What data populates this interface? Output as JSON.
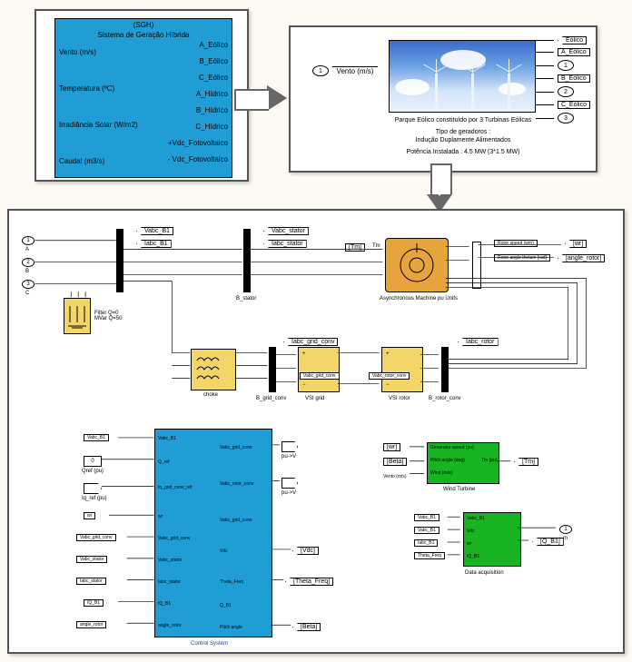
{
  "sgh": {
    "title": "(SGH)",
    "subtitle": "Sistema de Geração Híbrida",
    "inputs": [
      "Vento (m/s)",
      "Temperatura (ºC)",
      "Irradiância Solar (W/m2)",
      "Caudal (m3/s)"
    ],
    "outputs": [
      "A_Eólico",
      "B_Eólico",
      "C_Eólico",
      "A_Hídrico",
      "B_Hídrico",
      "C_Hídrico",
      "+Vdc_Fotovoltaico",
      "- Vdc_Fotovoltaico"
    ]
  },
  "wind": {
    "caption1": "Parque Eólico constituído por 3 Turbinas Eólicas",
    "caption2": "Tipo de geradoros :",
    "caption3": "Indução Duplamente Alimentados",
    "caption4": "Potência Instalada : 4.5 MW (3*1.5 MW)",
    "inport_num": "1",
    "inport_label": "Vento (m/s)",
    "out_eolico": "Eólico",
    "out_a": "A_Eólico",
    "out_a_num": "1",
    "out_b": "B_Eólico",
    "out_b_num": "2",
    "out_c": "C_Eólico",
    "out_c_num": "3"
  },
  "bottom": {
    "in_a": "1",
    "in_a_lab": "A",
    "in_b": "2",
    "in_b_lab": "B",
    "in_c": "3",
    "in_c_lab": "C",
    "out_m": "1",
    "out_m_lab": "m",
    "vabc_b1": "Vabc_B1",
    "iabc_b1": "Iabc_B1",
    "vabc_stator": "Vabc_stator",
    "iabc_stator": "Iabc_stator",
    "iabc_grid_conv": "Iabc_grid_conv",
    "iabc_rotor": "Iabc_rotor",
    "vabc_grid_conv": "Vabc_grid_conv",
    "vabc_rotor_conv": "Vabc_rotor_conv",
    "filter": "Filter\\nQ=0 MVar\\nQ=50",
    "b_stator": "B_stator",
    "b_grid_conv": "B_grid_conv",
    "b_rotor_conv": "B_rotor_conv",
    "vsi_grid": "VSI grid",
    "vsi_rotor": "VSI rotor",
    "choke": "choke",
    "async_mach": "Asynchronous Machine\\npu Units",
    "rotor_speed": "Rotor speed (wm)",
    "rotor_angle": "Rotor angle thetam [rad]",
    "tm": "Tm",
    "tm_tag": "[Tm]",
    "wr_tag": "[wr]",
    "angle_rotor": "[angle_rotor]",
    "gen_speed": "Generator speed (pu)",
    "pitch_deg": "Pitch angle (deg)",
    "wind_ms": "Wind (m/s)",
    "tm_pu": "Tm (pu)",
    "wind_turbine": "Wind Turbine",
    "beta": "[Beta]",
    "vento": "Vento (m/s)",
    "data_acq": "Data acquisition",
    "ctrl": {
      "name": "Control System",
      "in1": "Vabc_B1",
      "in2": "Q_ref",
      "in3": "Iq_grid_conv_ref",
      "in4": "wr",
      "in5": "Vabc_grid_conv",
      "in6": "Vabc_stator",
      "in7": "Iabc_stator",
      "in8": "IQ_B1",
      "in9": "angle_rotor",
      "out1": "Vabc_grid_conv",
      "out2": "Vabc_rotor_conv",
      "out3": "Vabc_grid_conv",
      "out4": "Vdc",
      "out5": "Theta_Freq",
      "out6": "Q_B1",
      "out7": "Pitch angle",
      "gain1": "pu->V",
      "gain2": "pu->V",
      "const0": "0",
      "const0_lab": "Qref (pu)",
      "iq_ref_lab": "Iq_ref (pu)",
      "vdc_tag": "[Vdc]",
      "tfreq_tag": "[Theta_Freq]",
      "beta_tag": "[Beta]"
    },
    "da_in": [
      "Vabc_B1",
      "Vabc_B1",
      "Iabc_B1",
      "Theta_Freq"
    ],
    "da_out": [
      "Vabc_B1",
      "Vdc",
      "wr",
      "IQ_B1"
    ],
    "q_b1_tag": "[Q_B1]"
  }
}
